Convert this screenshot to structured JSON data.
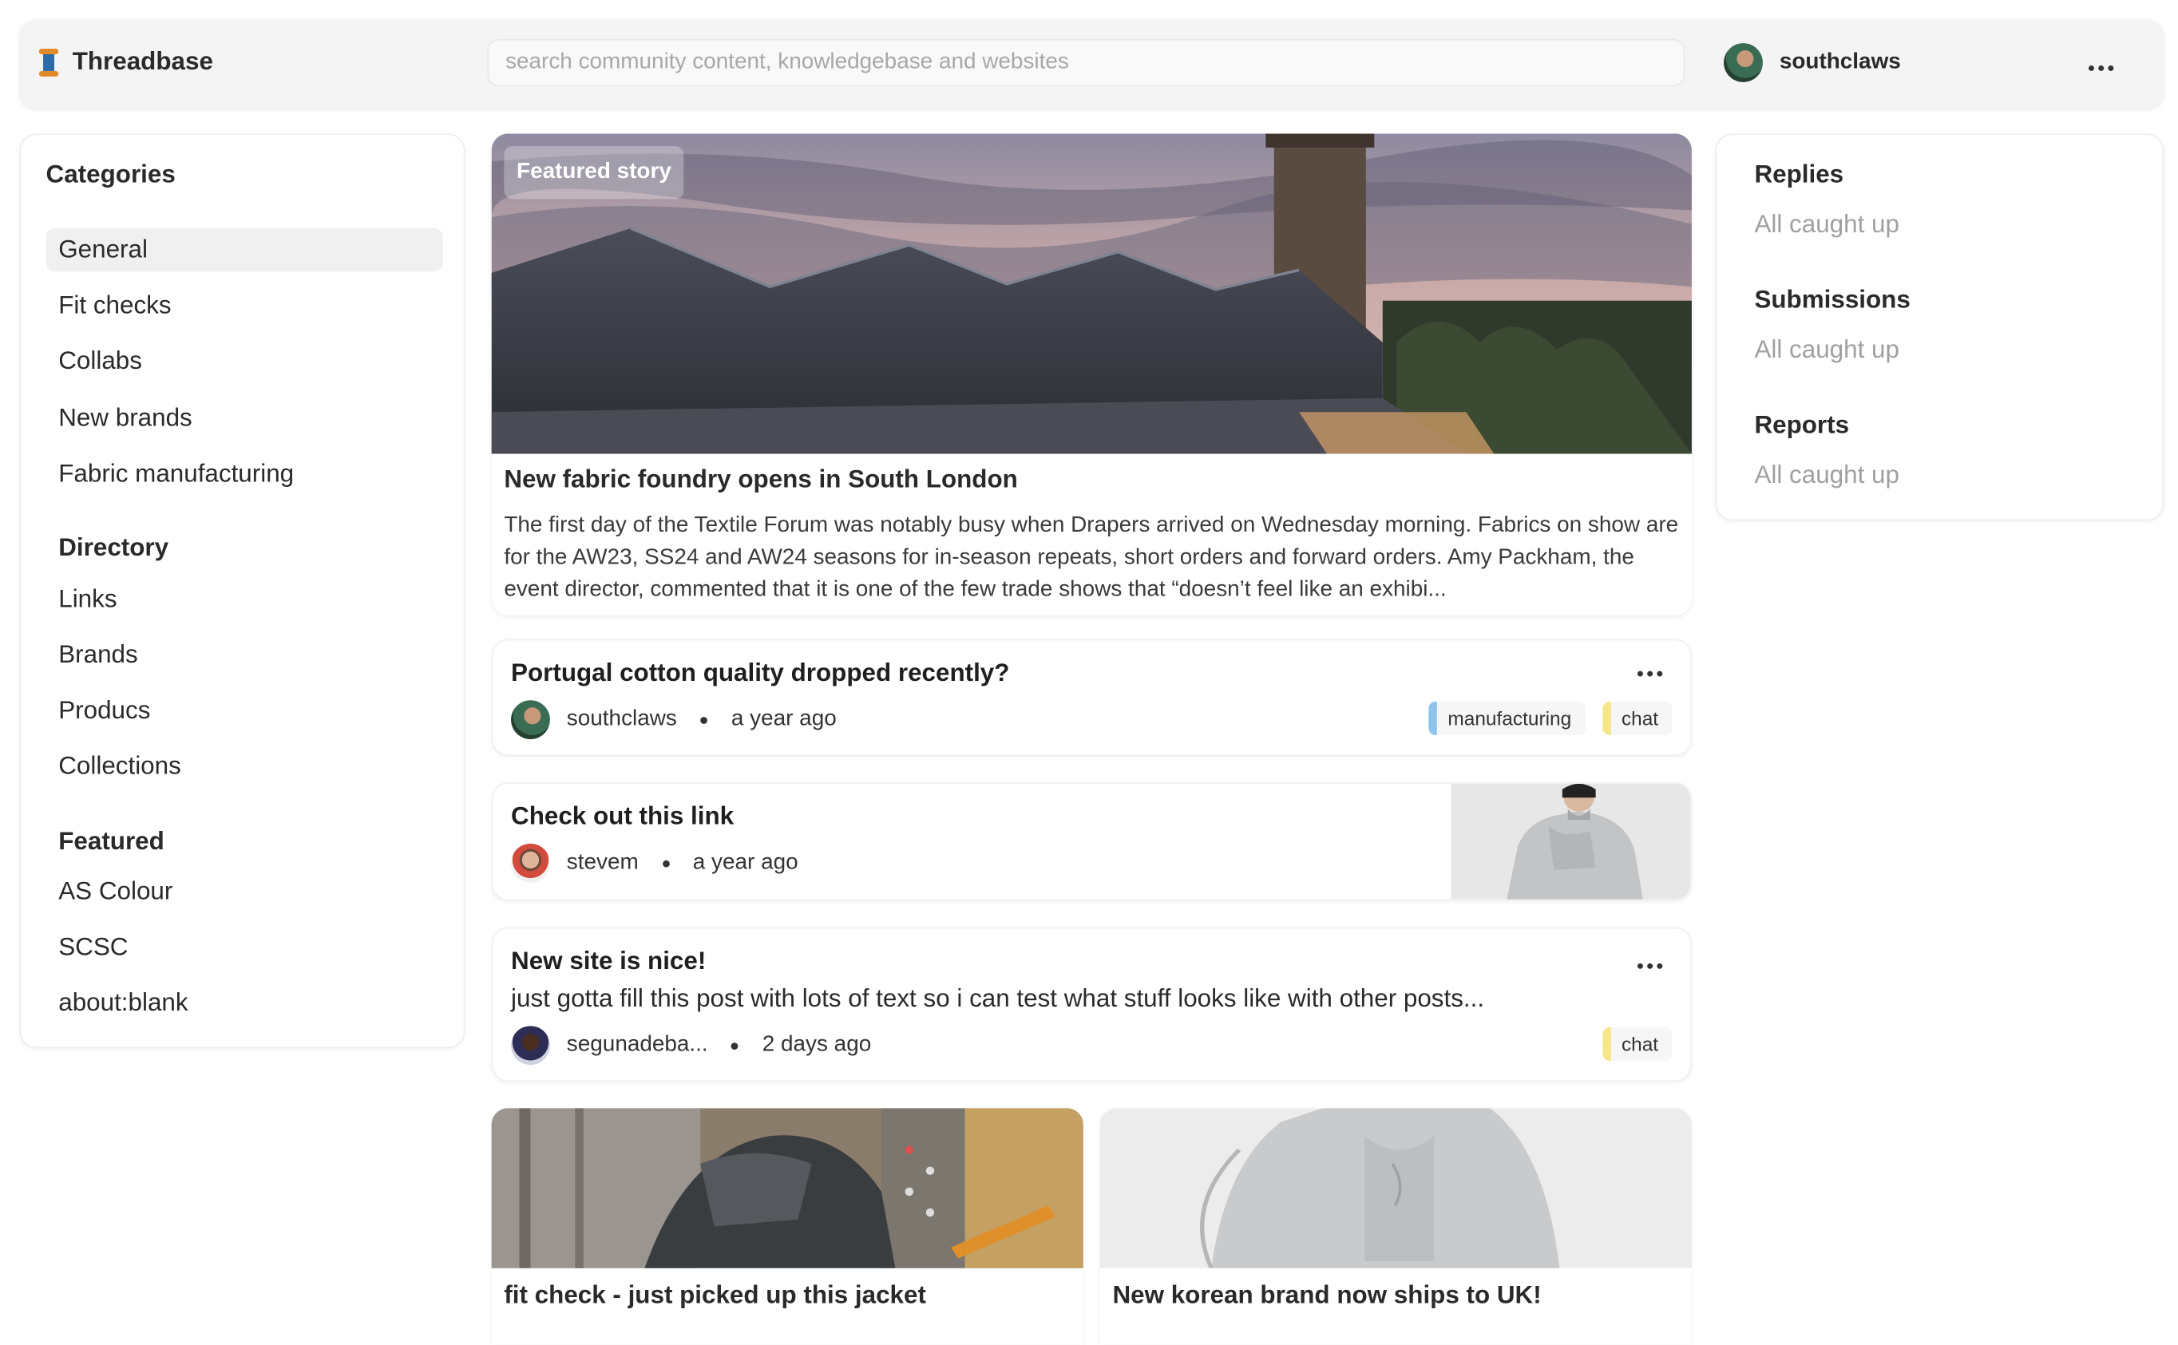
{
  "header": {
    "app_name": "Threadbase",
    "search_placeholder": "search community content, knowledgebase and websites",
    "username": "southclaws"
  },
  "sidebar": {
    "title": "Categories",
    "categories": [
      "General",
      "Fit checks",
      "Collabs",
      "New brands",
      "Fabric manufacturing"
    ],
    "directory_heading": "Directory",
    "directory": [
      "Links",
      "Brands",
      "Producs",
      "Collections"
    ],
    "featured_heading": "Featured",
    "featured": [
      "AS Colour",
      "SCSC",
      "about:blank"
    ]
  },
  "featured_story": {
    "badge": "Featured story",
    "title": "New fabric foundry opens in South London",
    "body": "The first day of the Textile Forum was notably busy when Drapers arrived on Wednesday morning. Fabrics on show are for the AW23, SS24 and AW24 seasons for in-season repeats, short orders and forward orders. Amy Packham, the event director, commented that it is one of the few trade shows that “doesn’t feel like an exhibi..."
  },
  "posts": [
    {
      "title": "Portugal cotton quality dropped recently?",
      "author": "southclaws",
      "time": "a year ago",
      "tags": [
        "manufacturing",
        "chat"
      ]
    },
    {
      "title": "Check out this link",
      "author": "stevem",
      "time": "a year ago"
    },
    {
      "title": "New site is nice!",
      "excerpt": "just gotta fill this post with lots of text so i can test what stuff looks like with other posts...",
      "author": "segunadeba...",
      "time": "2 days ago",
      "tags": [
        "chat"
      ]
    }
  ],
  "tiles": [
    {
      "title": "fit check - just picked up this jacket"
    },
    {
      "title": "New korean brand now ships to UK!"
    }
  ],
  "right_panel": {
    "sections": [
      {
        "heading": "Replies",
        "status": "All caught up"
      },
      {
        "heading": "Submissions",
        "status": "All caught up"
      },
      {
        "heading": "Reports",
        "status": "All caught up"
      }
    ]
  },
  "colors": {
    "tag_manufacturing": "#8fc3ee",
    "tag_chat": "#f7e58a",
    "muted_text": "#a0a0a0"
  }
}
